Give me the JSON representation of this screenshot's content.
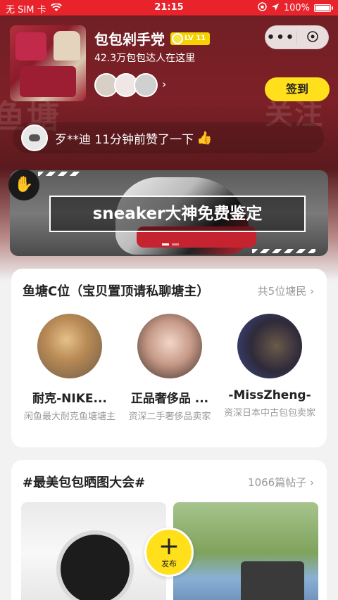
{
  "status_bar": {
    "carrier": "无 SIM 卡",
    "time": "21:15",
    "battery": "100%"
  },
  "group": {
    "name": "包包剁手党",
    "level": "LV 11",
    "members_text": "42.3万包包达人在这里",
    "sign_in_label": "签到",
    "more_label": "•••",
    "close_label": "✕"
  },
  "activity": {
    "text": "歹**迪 11分钟前赞了一下"
  },
  "banner": {
    "title": "sneaker大神免费鉴定"
  },
  "c_position": {
    "title": "鱼塘C位（宝贝置顶请私聊塘主）",
    "count": "共5位塘民",
    "members": [
      {
        "name": "耐克-NIKE...",
        "desc": "闲鱼最大耐克鱼塘塘主"
      },
      {
        "name": "正品奢侈品 ...",
        "desc": "资深二手奢侈品卖家"
      },
      {
        "name": "-MissZheng-",
        "desc": "资深日本中古包包卖家"
      }
    ]
  },
  "topic": {
    "title": "#最美包包晒图大会#",
    "count": "1066篇帖子"
  },
  "fab": {
    "label": "发布"
  }
}
